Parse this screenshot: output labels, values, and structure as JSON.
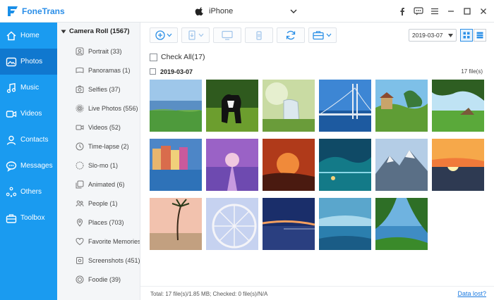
{
  "app": {
    "name": "FoneTrans"
  },
  "device": {
    "name": "iPhone"
  },
  "sidebar": {
    "items": [
      {
        "label": "Home",
        "icon": "home-icon"
      },
      {
        "label": "Photos",
        "icon": "photos-icon",
        "active": true
      },
      {
        "label": "Music",
        "icon": "music-icon"
      },
      {
        "label": "Videos",
        "icon": "videos-icon"
      },
      {
        "label": "Contacts",
        "icon": "contacts-icon"
      },
      {
        "label": "Messages",
        "icon": "messages-icon"
      },
      {
        "label": "Others",
        "icon": "others-icon"
      },
      {
        "label": "Toolbox",
        "icon": "toolbox-icon"
      }
    ]
  },
  "tree": {
    "root": "Camera Roll (1567)",
    "items": [
      {
        "label": "Portrait (33)",
        "icon": "portrait-icon"
      },
      {
        "label": "Panoramas (1)",
        "icon": "panorama-icon"
      },
      {
        "label": "Selfies (37)",
        "icon": "selfie-icon"
      },
      {
        "label": "Live Photos (556)",
        "icon": "live-photo-icon"
      },
      {
        "label": "Videos (52)",
        "icon": "video-icon"
      },
      {
        "label": "Time-lapse (2)",
        "icon": "time-lapse-icon"
      },
      {
        "label": "Slo-mo (1)",
        "icon": "slo-mo-icon"
      },
      {
        "label": "Animated (6)",
        "icon": "animated-icon"
      },
      {
        "label": "People (1)",
        "icon": "people-icon"
      },
      {
        "label": "Places (703)",
        "icon": "places-icon"
      },
      {
        "label": "Favorite Memories (...",
        "icon": "heart-icon"
      },
      {
        "label": "Screenshots (451)",
        "icon": "screenshot-icon"
      },
      {
        "label": "Foodie (39)",
        "icon": "foodie-icon"
      }
    ]
  },
  "toolbar": {
    "date_value": "2019-03-07"
  },
  "content": {
    "check_all_label": "Check All(17)",
    "group_date": "2019-03-07",
    "group_count": "17 file(s)"
  },
  "status": {
    "summary": "Total: 17 file(s)/1.85 MB; Checked: 0 file(s)/N/A",
    "link": "Data lost?"
  },
  "colors": {
    "sidebar": "#1a9bf0",
    "sidebar_active": "#1078cf",
    "accent": "#2b8fe6"
  }
}
